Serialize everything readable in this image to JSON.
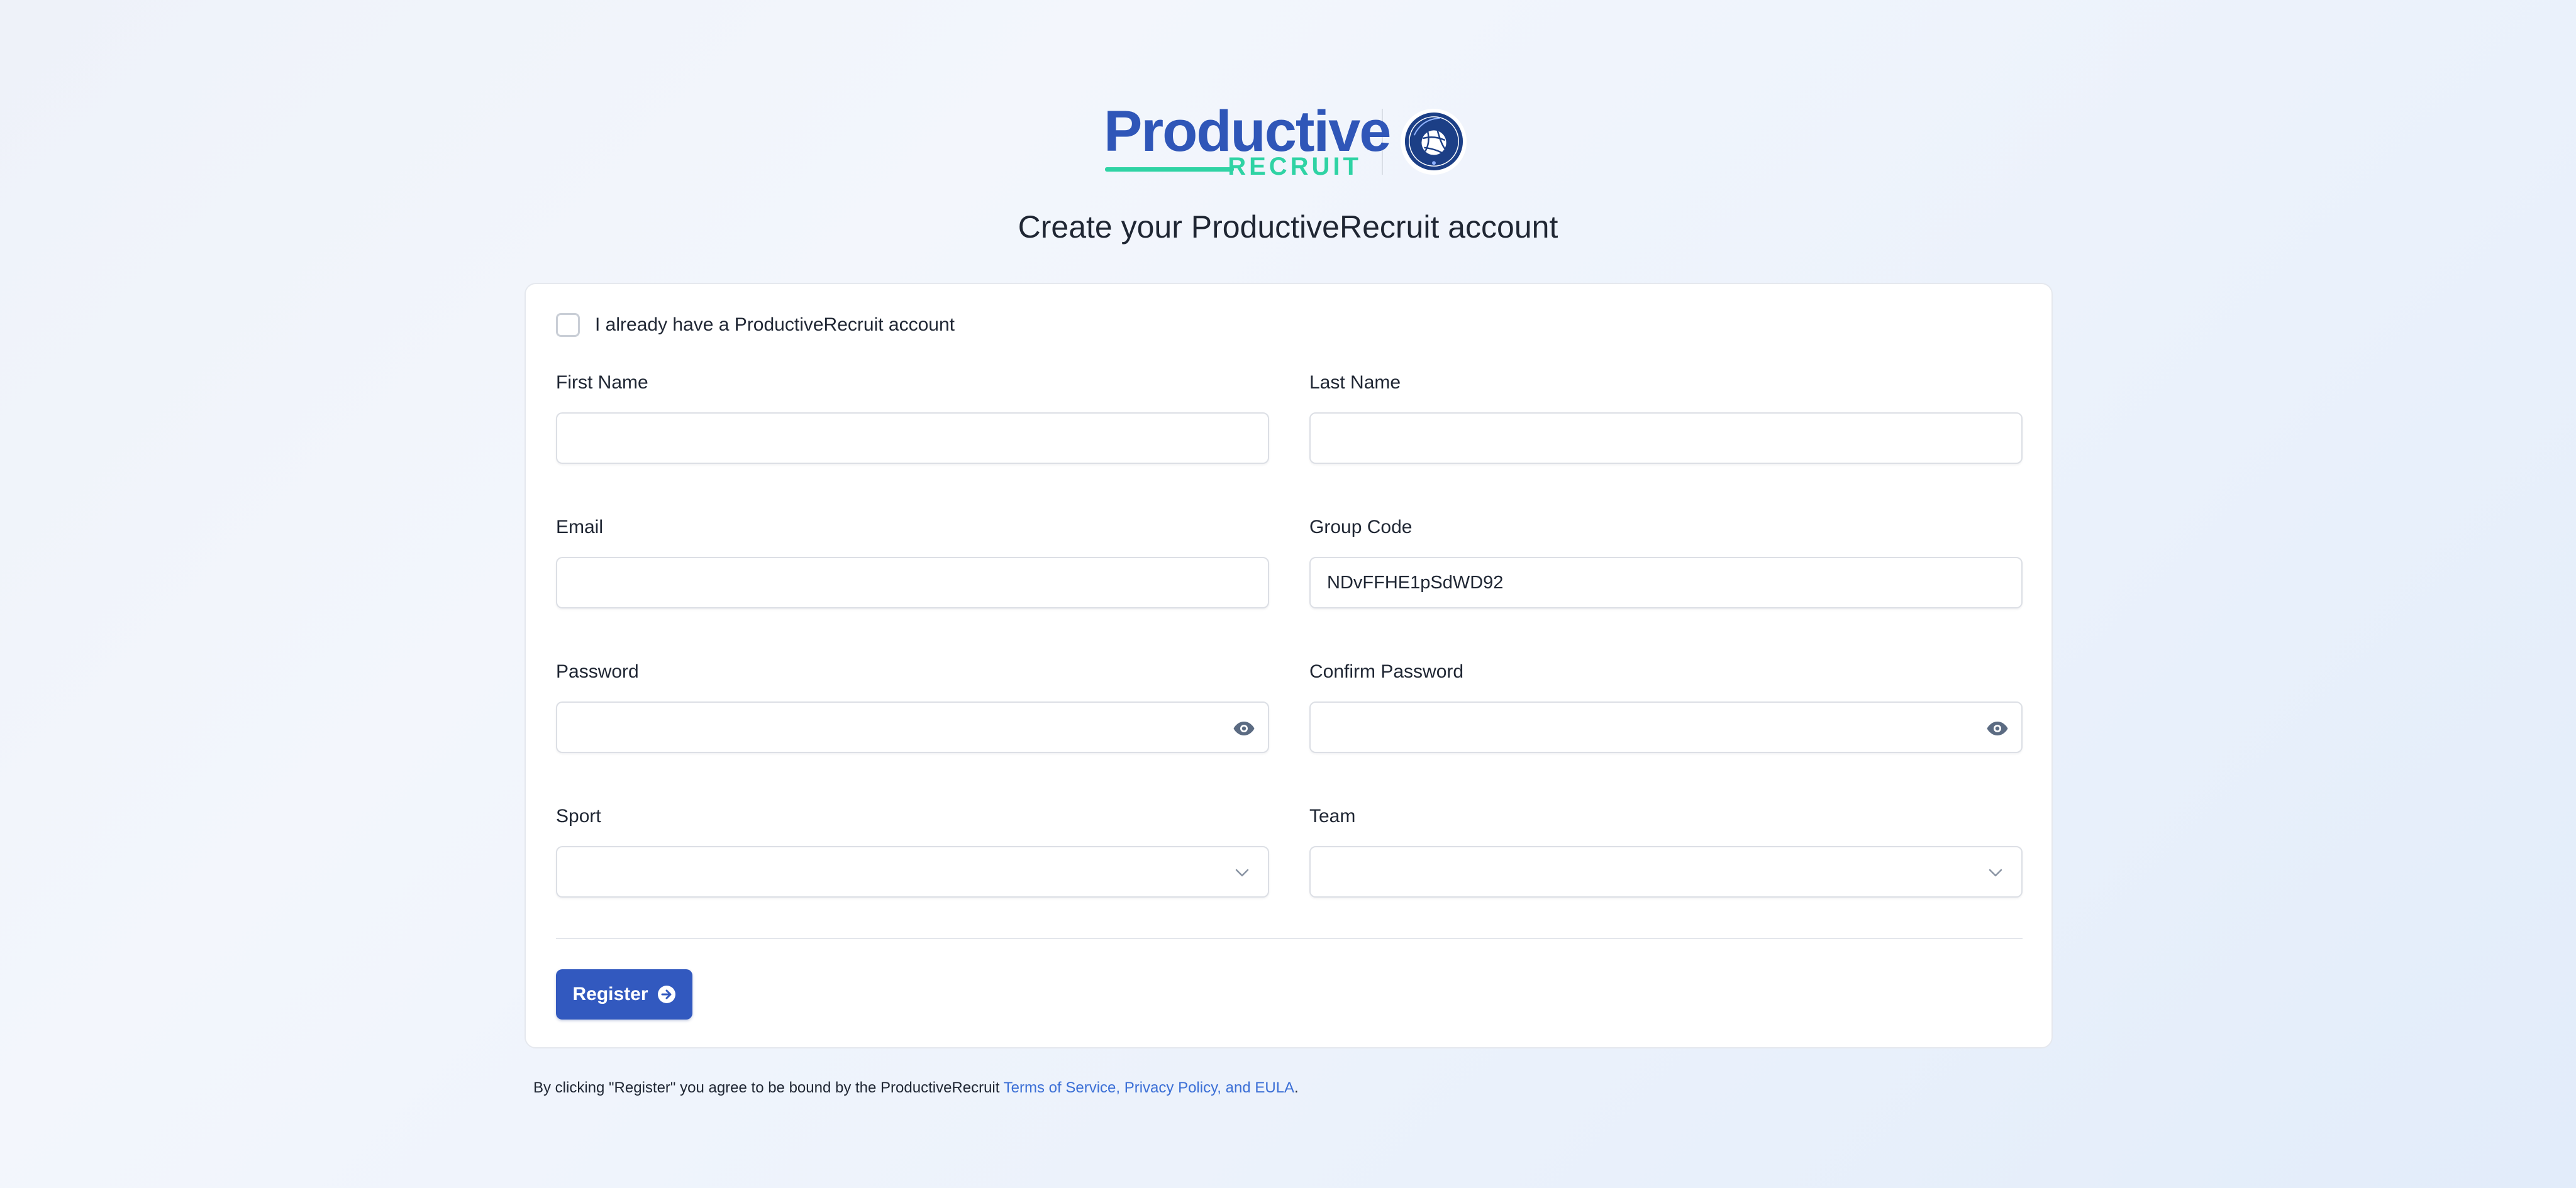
{
  "brand": {
    "wordmark_main": "Productive",
    "wordmark_sub": "RECRUIT",
    "club_badge_top": "SKYLINE SURGE",
    "club_badge_bottom": "VBC",
    "primary_color": "#2f56b8",
    "accent_color": "#2fd3a4"
  },
  "page_title": "Create your ProductiveRecruit account",
  "form": {
    "existing_account_label": "I already have a ProductiveRecruit account",
    "existing_account_checked": false,
    "first_name": {
      "label": "First Name",
      "value": ""
    },
    "last_name": {
      "label": "Last Name",
      "value": ""
    },
    "email": {
      "label": "Email",
      "value": ""
    },
    "group_code": {
      "label": "Group Code",
      "value": "NDvFFHE1pSdWD92"
    },
    "password": {
      "label": "Password",
      "value": ""
    },
    "confirm_password": {
      "label": "Confirm Password",
      "value": ""
    },
    "sport": {
      "label": "Sport",
      "selected": ""
    },
    "team": {
      "label": "Team",
      "selected": ""
    },
    "register_label": "Register",
    "register_color": "#3259bf"
  },
  "legal": {
    "prefix": "By clicking \"Register\" you agree to be bound by the ProductiveRecruit ",
    "link_text": "Terms of Service, Privacy Policy, and EULA",
    "suffix": "."
  }
}
